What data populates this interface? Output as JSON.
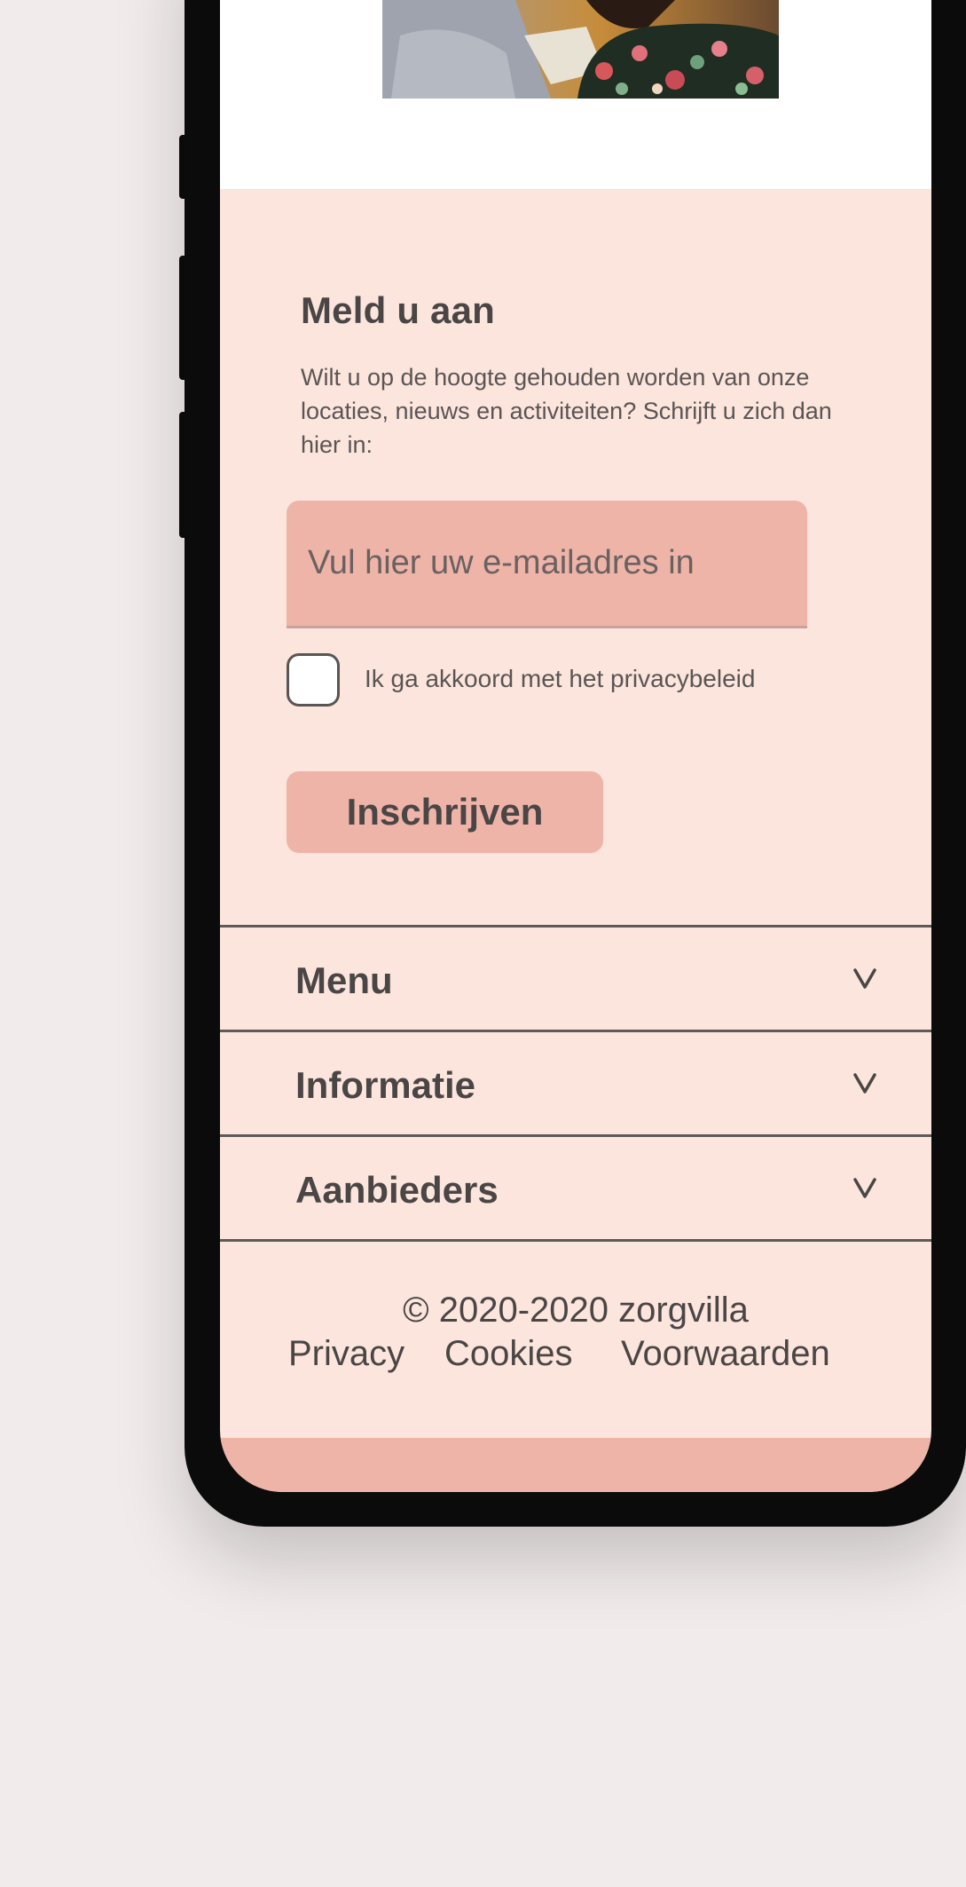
{
  "signup": {
    "title": "Meld u aan",
    "description": "Wilt u op de hoogte gehouden worden van onze locaties, nieuws en activiteiten? Schrijft u zich dan hier in:",
    "email_placeholder": "Vul hier uw e-mailadres in",
    "email_value": "",
    "privacy_label": "Ik ga akkoord met het privacybeleid",
    "privacy_checked": false,
    "submit_label": "Inschrijven"
  },
  "accordion": {
    "items": [
      {
        "label": "Menu",
        "icon": "chevron-down-icon"
      },
      {
        "label": "Informatie",
        "icon": "chevron-down-icon"
      },
      {
        "label": "Aanbieders",
        "icon": "chevron-down-icon"
      }
    ]
  },
  "footer": {
    "copyright": "© 2020-2020 zorgvilla",
    "links": [
      "Privacy",
      "Cookies",
      "Voorwaarden"
    ]
  },
  "colors": {
    "page_background": "#f1eceb",
    "screen_background": "#fce5dc",
    "accent_pink": "#efb4a8",
    "text_dark": "#4a4646",
    "device_frame": "#0b0b0b"
  }
}
